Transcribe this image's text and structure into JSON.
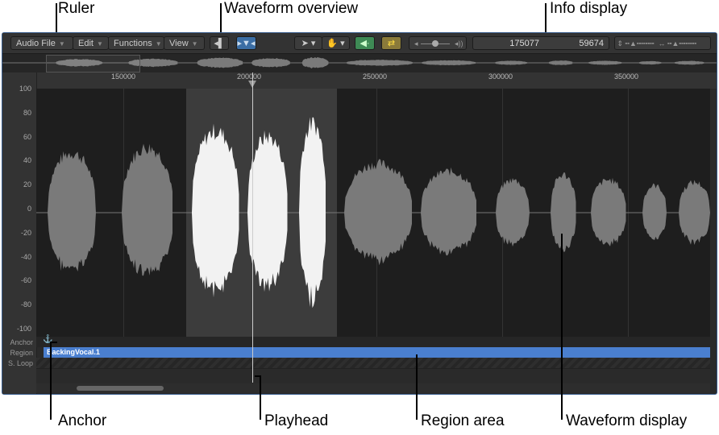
{
  "callouts": {
    "ruler": "Ruler",
    "overview": "Waveform overview",
    "info": "Info display",
    "anchor": "Anchor",
    "playhead": "Playhead",
    "region_area": "Region area",
    "waveform_display": "Waveform display"
  },
  "toolbar": {
    "audio_file": "Audio File",
    "edit": "Edit",
    "functions": "Functions",
    "view": "View"
  },
  "info": {
    "position": "175077",
    "length": "59674"
  },
  "ruler": {
    "ticks": [
      "150000",
      "200000",
      "250000",
      "300000",
      "350000"
    ]
  },
  "yaxis": [
    "100",
    "80",
    "60",
    "40",
    "20",
    "0",
    "-20",
    "-40",
    "-60",
    "-80",
    "-100"
  ],
  "rows": {
    "anchor": "Anchor",
    "region": "Region",
    "sloop": "S. Loop"
  },
  "region": {
    "name": "BackingVocal.1",
    "color": "#4a7fcf"
  }
}
